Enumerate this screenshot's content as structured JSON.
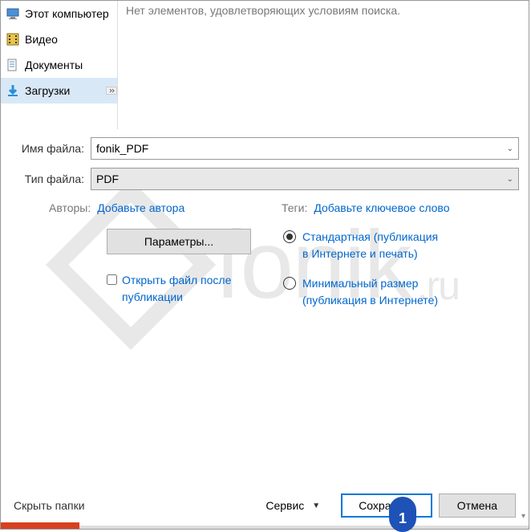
{
  "sidebar": {
    "items": [
      {
        "label": "Этот компьютер",
        "icon": "computer-icon"
      },
      {
        "label": "Видео",
        "icon": "video-icon"
      },
      {
        "label": "Документы",
        "icon": "documents-icon"
      },
      {
        "label": "Загрузки",
        "icon": "downloads-icon",
        "selected": true
      }
    ]
  },
  "main": {
    "empty_message": "Нет элементов, удовлетворяющих условиям поиска."
  },
  "form": {
    "filename_label": "Имя файла:",
    "filename_value": "fonik_PDF",
    "filetype_label": "Тип файла:",
    "filetype_value": "PDF"
  },
  "meta": {
    "authors_label": "Авторы:",
    "authors_link": "Добавьте автора",
    "tags_label": "Теги:",
    "tags_link": "Добавьте ключевое слово"
  },
  "options": {
    "params_button": "Параметры...",
    "open_after_label": "Открыть файл после публикации",
    "radio_standard": "Стандартная (публикация в Интернете и печать)",
    "radio_minimal": "Минимальный размер (публикация в Интернете)"
  },
  "bottom": {
    "hide_folders": "Скрыть папки",
    "service": "Сервис",
    "save": "Сохранить",
    "cancel": "Отмена"
  },
  "callout": {
    "number": "1"
  },
  "watermark": {
    "text": "fonik",
    "suffix": ".ru"
  }
}
